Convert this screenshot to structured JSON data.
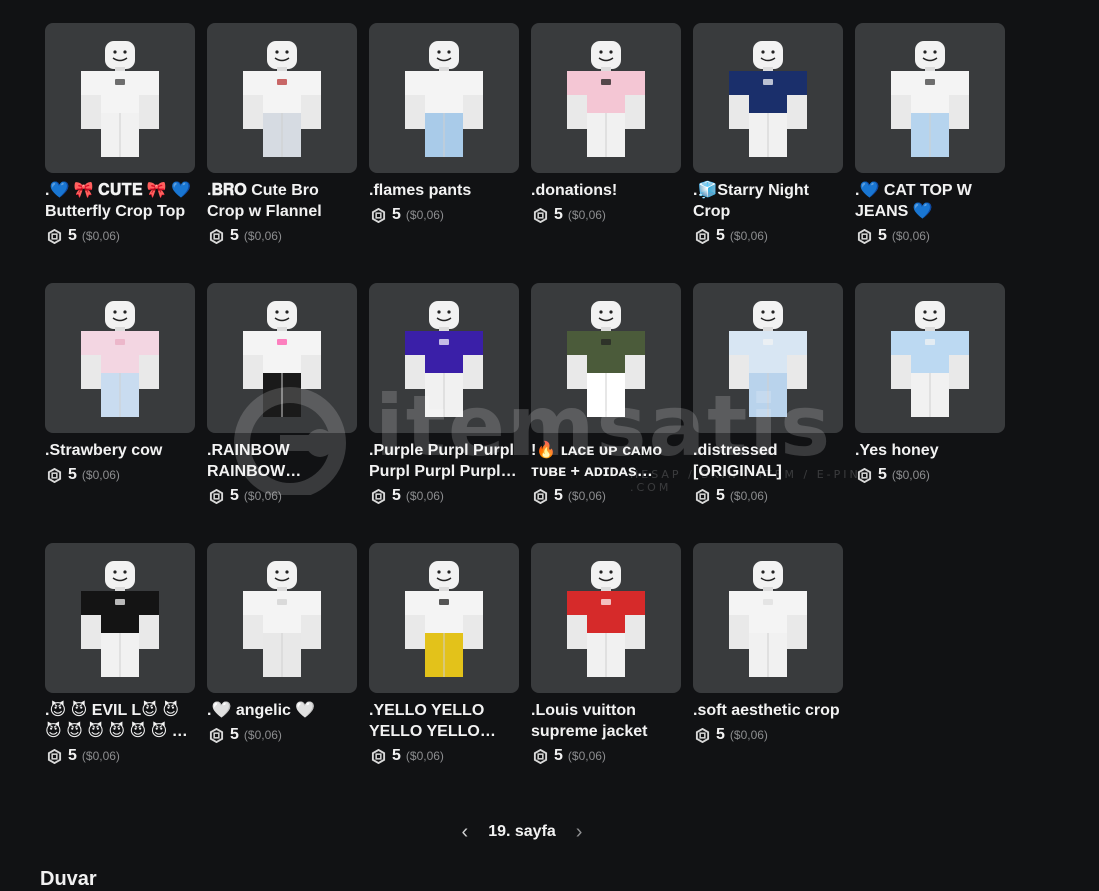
{
  "catalog": {
    "items": [
      {
        "name": ".💙 🎀 𝐂𝐔𝐓𝐄 🎀 💙 Butterfly Crop Top",
        "price": "5",
        "usd": "($0,06)",
        "top": "#f4f4f4",
        "bottom": "#f1f1f1",
        "decal": "#333333"
      },
      {
        "name": ".𝐁𝐑𝐎 Cute Bro Crop w Flannel",
        "price": "5",
        "usd": "($0,06)",
        "top": "#f4f4f4",
        "bottom": "#d6dbe2",
        "decal": "#b52a2a"
      },
      {
        "name": ".flames pants",
        "price": "5",
        "usd": "($0,06)",
        "top": "#f4f4f4",
        "bottom": "#a9cbe9",
        "decal": "#f4f4f4"
      },
      {
        "name": ".donations!",
        "price": "5",
        "usd": "($0,06)",
        "top": "#f4c6d4",
        "bottom": "#f1f1f1",
        "decal": "#111111"
      },
      {
        "name": ".🧊Starry Night Crop",
        "price": "5",
        "usd": "($0,06)",
        "top": "#1a2f6b",
        "bottom": "#f1f1f1",
        "decal": "#ffffff"
      },
      {
        "name": ".💙 CAT TOP W JEANS 💙",
        "price": "5",
        "usd": "($0,06)",
        "top": "#f4f4f4",
        "bottom": "#b6d4ee",
        "decal": "#333333"
      },
      {
        "name": ".Strawbery cow",
        "price": "5",
        "usd": "($0,06)",
        "top": "#f3d6e2",
        "bottom": "#c9dcf0",
        "decal": "#e8a9c1"
      },
      {
        "name": ".RAINBOW RAINBOW RAINBOW RAINBOW",
        "price": "5",
        "usd": "($0,06)",
        "top": "#f4f4f4",
        "bottom": "#1a1a1a",
        "decal": "#ff4da6"
      },
      {
        "name": ".Purple Purpl Purpl Purpl Purpl Purpl Purpl",
        "price": "5",
        "usd": "($0,06)",
        "top": "#3a1fa8",
        "bottom": "#f1f1f1",
        "decal": "#ffffff"
      },
      {
        "name": "!🔥 ʟᴀᴄᴇ ᴜᴘ ᴄᴀᴍᴏ ᴛᴜʙᴇ + ᴀᴅɪᴅᴀs sʜᴏʀᴛs",
        "price": "5",
        "usd": "($0,06)",
        "top": "#4b5b3a",
        "bottom": "#ffffff",
        "decal": "#222222"
      },
      {
        "name": ".distressed [ORIGINAL]",
        "price": "5",
        "usd": "($0,06)",
        "top": "#d8e6f3",
        "bottom": "#b9d3ec",
        "decal": "#f4f4f4"
      },
      {
        "name": ".Yes honey",
        "price": "5",
        "usd": "($0,06)",
        "top": "#bcd9f2",
        "bottom": "#f1f1f1",
        "decal": "#f4f4f4"
      },
      {
        "name": ".😈 😈 EVIL L😈 😈 😈 😈 😈 😈 😈 😈 😈 😈",
        "price": "5",
        "usd": "($0,06)",
        "top": "#141414",
        "bottom": "#f1f1f1",
        "decal": "#ffffff"
      },
      {
        "name": ".🤍 angelic 🤍",
        "price": "5",
        "usd": "($0,06)",
        "top": "#f4f4f4",
        "bottom": "#e8e8e8",
        "decal": "#cfcfcf"
      },
      {
        "name": ".YELLO YELLO YELLO YELLO YELLO",
        "price": "5",
        "usd": "($0,06)",
        "top": "#f4f4f4",
        "bottom": "#e3c21a",
        "decal": "#111111"
      },
      {
        "name": ".Louis vuitton supreme jacket",
        "price": "5",
        "usd": "($0,06)",
        "top": "#d62a2a",
        "bottom": "#f1f1f1",
        "decal": "#ffffff"
      },
      {
        "name": ".soft aesthetic crop",
        "price": "5",
        "usd": "($0,06)",
        "top": "#f4f4f4",
        "bottom": "#f1f1f1",
        "decal": "#dddddd"
      }
    ]
  },
  "pagination": {
    "prev_icon": "chevron-left-icon",
    "label": "19. sayfa",
    "next_icon": "chevron-right-icon"
  },
  "section": {
    "title": "Duvar"
  },
  "watermark": {
    "brand": "itemsatis",
    "sub": "HESAP / SKIN / ITEM / E-PIN .COM"
  },
  "colors": {
    "background": "#111214",
    "card": "#393b3d",
    "muted_text": "#8c8d8f"
  }
}
